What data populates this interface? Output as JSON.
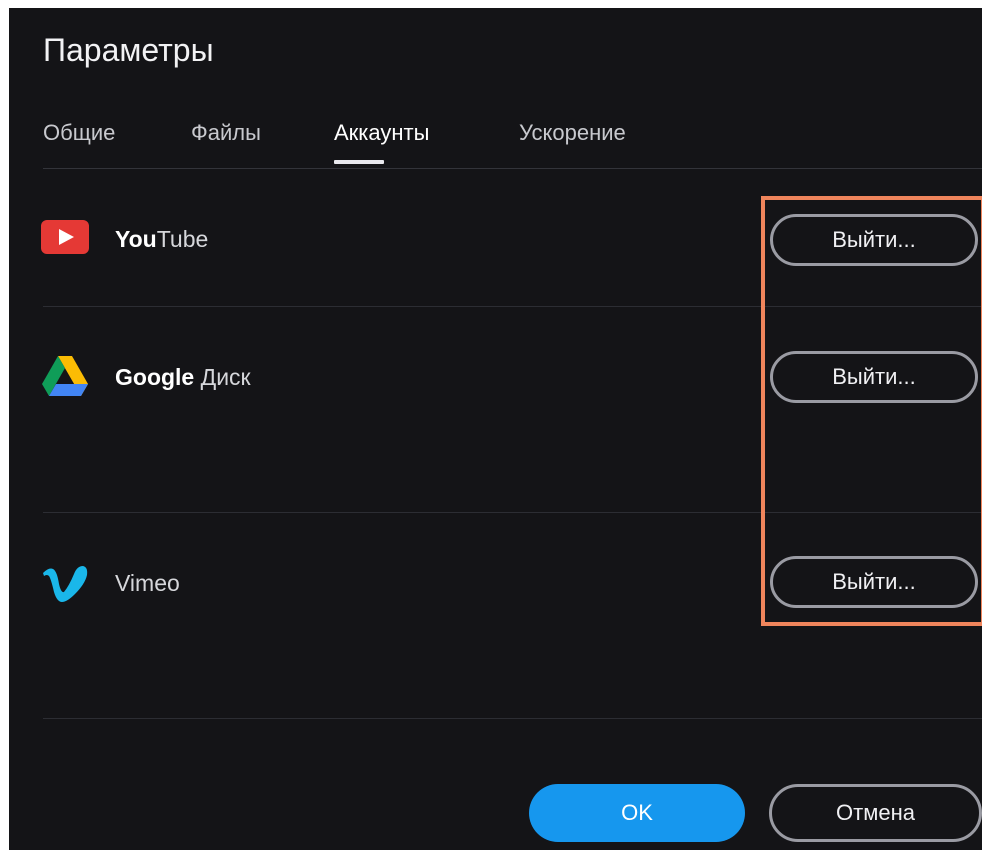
{
  "dialog": {
    "title": "Параметры"
  },
  "tabs": [
    {
      "label": "Общие",
      "active": false
    },
    {
      "label": "Файлы",
      "active": false
    },
    {
      "label": "Аккаунты",
      "active": true
    },
    {
      "label": "Ускорение",
      "active": false
    }
  ],
  "accounts": [
    {
      "icon": "youtube-icon",
      "name_bold": "You",
      "name_rest": "Tube",
      "button": "Выйти..."
    },
    {
      "icon": "google-drive-icon",
      "name_bold": "Google",
      "name_rest": " Диск",
      "button": "Выйти..."
    },
    {
      "icon": "vimeo-icon",
      "name_bold": "",
      "name_rest": "Vimeo",
      "button": "Выйти..."
    }
  ],
  "footer": {
    "ok_label": "OK",
    "cancel_label": "Отмена"
  },
  "colors": {
    "background": "#141417",
    "accent": "#1697ee",
    "highlight": "#f0855c",
    "youtube": "#e53935",
    "vimeo": "#1ab7ea"
  }
}
